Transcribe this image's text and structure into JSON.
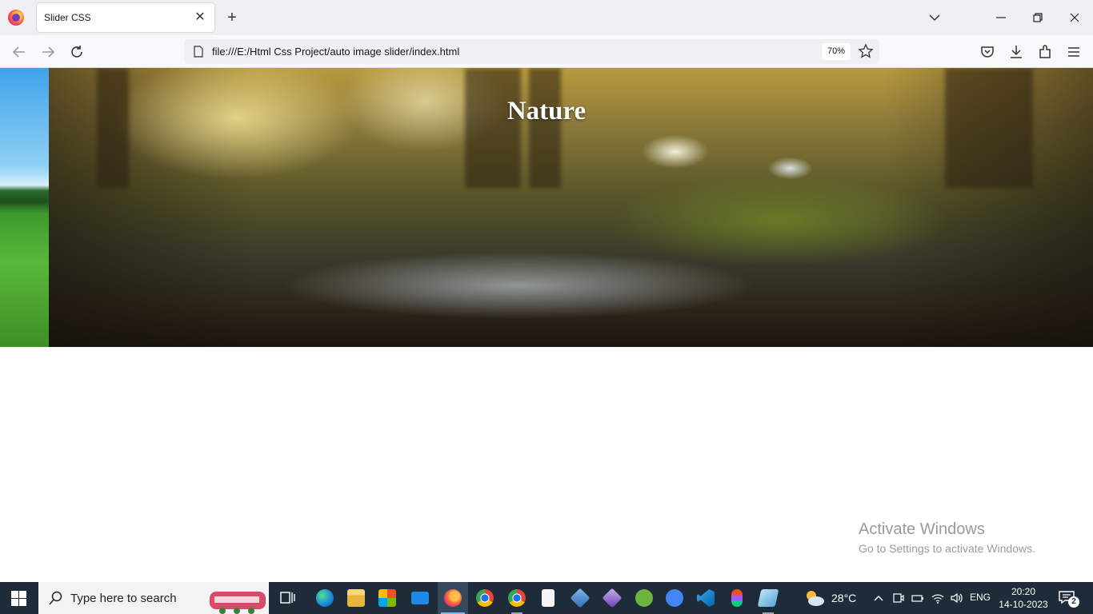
{
  "browser": {
    "tab_title": "Slider CSS",
    "tab_close": "✕",
    "new_tab": "+",
    "url": "file:///E:/Html Css Project/auto image slider/index.html",
    "zoom": "70%",
    "icons": [
      "firefox-logo",
      "back-icon",
      "forward-icon",
      "reload-icon",
      "page-icon",
      "star-icon",
      "pocket-icon",
      "download-icon",
      "extensions-icon",
      "menu-icon",
      "tabs-list-icon",
      "minimize-icon",
      "restore-icon",
      "close-icon"
    ]
  },
  "page": {
    "slide_title": "Nature"
  },
  "watermark": {
    "title": "Activate Windows",
    "subtitle": "Go to Settings to activate Windows."
  },
  "taskbar": {
    "search_placeholder": "Type here to search",
    "apps": [
      "task-view",
      "edge",
      "file-explorer",
      "microsoft-store",
      "mail",
      "firefox",
      "chrome",
      "chrome-profile",
      "notepad",
      "app-cube-blue",
      "app-cube-purple",
      "spring-tool",
      "android-studio",
      "vscode",
      "figma",
      "app-book"
    ],
    "active_app": "firefox",
    "weather": "28°C",
    "language": "ENG",
    "time": "20:20",
    "date": "14-10-2023",
    "notification_count": "2"
  },
  "colors": {
    "taskbar": "#1e2c3a",
    "tab_bar": "#f0f0f4",
    "accent": "#76b9ed"
  }
}
